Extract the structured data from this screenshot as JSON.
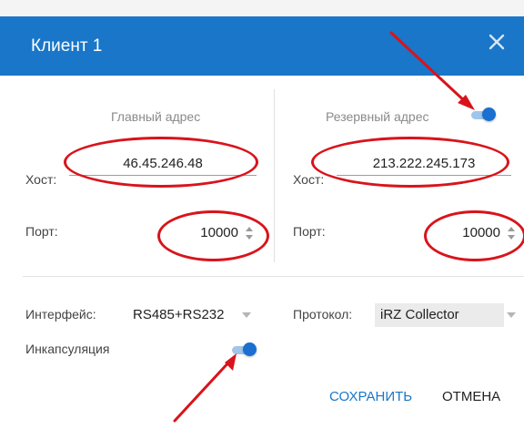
{
  "dialog": {
    "title": "Клиент 1",
    "close_icon": "close-icon"
  },
  "primary": {
    "section_title": "Главный адрес",
    "host_label": "Хост:",
    "host_value": "46.45.246.48",
    "port_label": "Порт:",
    "port_value": "10000"
  },
  "backup": {
    "section_title": "Резервный адрес",
    "toggle_on": true,
    "host_label": "Хост:",
    "host_value": "213.222.245.173",
    "port_label": "Порт:",
    "port_value": "10000"
  },
  "interface": {
    "label": "Интерфейс:",
    "value": "RS485+RS232"
  },
  "protocol": {
    "label": "Протокол:",
    "value": "iRZ Collector"
  },
  "encapsulation": {
    "label": "Инкапсуляция",
    "toggle_on": true
  },
  "actions": {
    "save_label": "СОХРАНИТЬ",
    "cancel_label": "ОТМЕНА"
  },
  "colors": {
    "header": "#1976c8",
    "accent": "#1a6fd0",
    "annotation": "#d9131b"
  }
}
